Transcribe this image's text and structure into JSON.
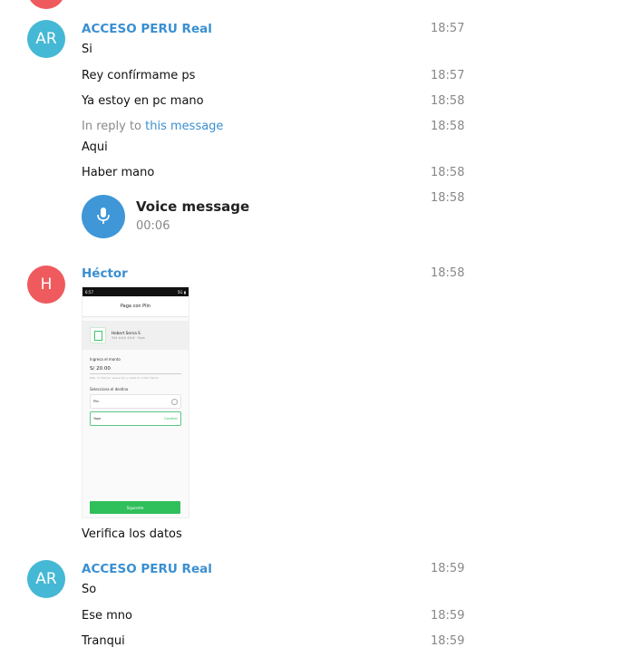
{
  "colors": {
    "accent": "#3a8fd1",
    "avatar_ar": "#45b8d5",
    "avatar_h": "#ef5a5e",
    "voice_button": "#3f97d8"
  },
  "messages": {
    "g1": {
      "avatar": "AR",
      "sender": "ACCESO PERU Real",
      "m1": {
        "text": "Si",
        "time": "18:57"
      },
      "m2": {
        "text": "Rey confírmame ps",
        "time": "18:57"
      },
      "m3": {
        "text": "Ya estoy en pc mano",
        "time": "18:58"
      },
      "m4": {
        "reply_prefix": "In reply to",
        "reply_link": "this message",
        "text": "Aqui",
        "time": "18:58"
      },
      "m5": {
        "text": "Haber mano",
        "time": "18:58"
      },
      "voice": {
        "title": "Voice message",
        "duration": "00:06",
        "time": "18:58",
        "icon": "microphone-icon"
      }
    },
    "g2": {
      "avatar": "H",
      "sender": "Héctor",
      "time": "18:58",
      "caption": "Verifica los datos",
      "screenshot": {
        "status_left": "6:57",
        "status_right": "5G ▮",
        "title": "Paga con Plin",
        "contact_name": "Hebert Serna S",
        "contact_sub": "944 ### ### · Yape",
        "amount_label": "Ingresa el monto",
        "amount": "S/ 20.00",
        "hint": "Máx. S/ 500 por operación y hasta S/ 2,000 diarios",
        "dest_label": "Selecciona el destino",
        "option1": "Plin",
        "option2": "Yape",
        "option2_action": "Cambiar",
        "button": "Siguiente"
      }
    },
    "g3": {
      "avatar": "AR",
      "sender": "ACCESO PERU Real",
      "m1": {
        "text": "So",
        "time": "18:59"
      },
      "m2": {
        "text": "Ese mno",
        "time": "18:59"
      },
      "m3": {
        "text": "Tranqui",
        "time": "18:59"
      }
    }
  }
}
